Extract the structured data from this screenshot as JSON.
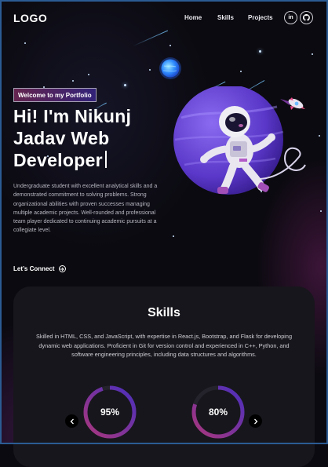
{
  "nav": {
    "logo": "LOGO",
    "links": [
      {
        "label": "Home"
      },
      {
        "label": "Skills"
      },
      {
        "label": "Projects"
      }
    ],
    "socials": [
      {
        "icon": "linkedin-icon",
        "text": "in"
      },
      {
        "icon": "github-icon"
      }
    ]
  },
  "hero": {
    "tagline": "Welcome to my Portfolio",
    "headline_lines": [
      "Hi! I'm Nikunj",
      "Jadav Web",
      "Developer"
    ],
    "intro": "Undergraduate student with excellent analytical skills and a demonstrated commitment to solving problems. Strong organizational abilities with proven successes managing multiple academic projects. Well-rounded and professional team player dedicated to continuing academic pursuits at a collegiate level.",
    "cta": "Let’s Connect"
  },
  "skills": {
    "title": "Skills",
    "description": "Skilled in HTML, CSS, and JavaScript, with expertise in React.js, Bootstrap, and Flask for developing dynamic web applications. Proficient in Git for version control and experienced in C++, Python, and software engineering principles, including data structures and algorithms.",
    "meters": [
      {
        "label": "95%",
        "value": 95
      },
      {
        "label": "80%",
        "value": 80
      }
    ]
  },
  "colors": {
    "background": "#0b0a10",
    "card": "#17161c",
    "gradient_start": "#aa367c",
    "gradient_end": "#4a2fbd",
    "planet": "#6f4bd8"
  }
}
